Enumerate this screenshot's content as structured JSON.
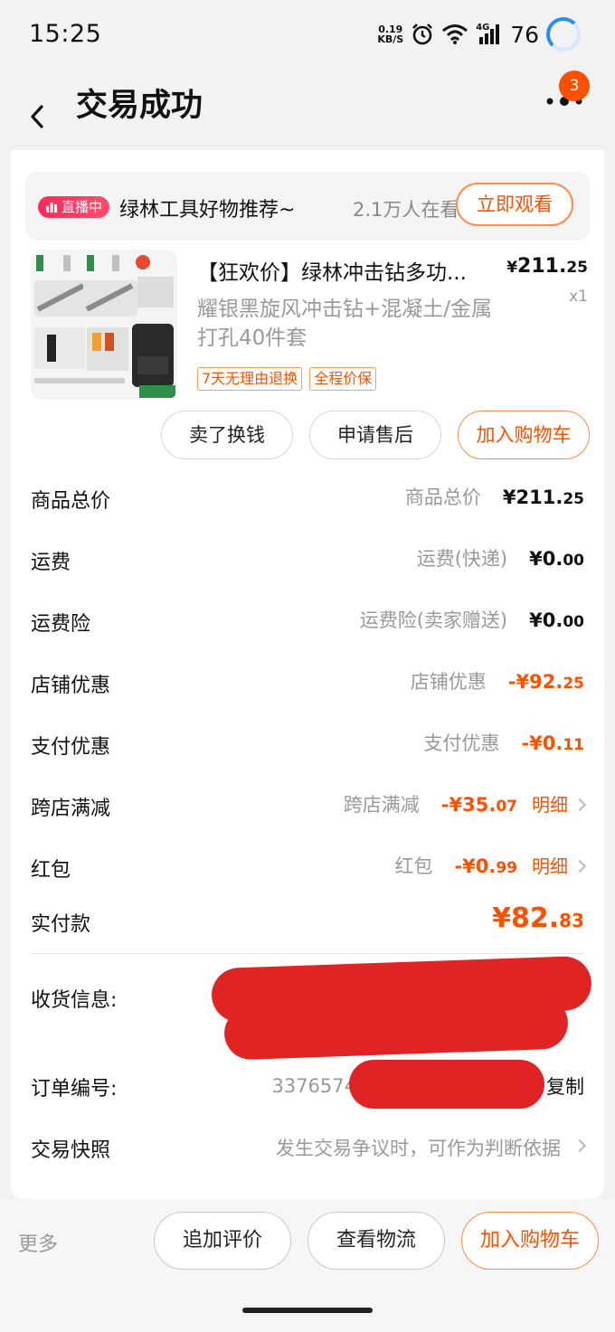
{
  "status_bar": {
    "time": "15:25",
    "net_speed_value": "0.19",
    "net_speed_unit": "KB/S",
    "network_label": "4G",
    "battery": "76"
  },
  "header": {
    "title": "交易成功",
    "badge_count": "3"
  },
  "live": {
    "badge": "直播中",
    "title": "绿林工具好物推荐~",
    "viewers": "2.1万人在看",
    "watch_button": "立即观看"
  },
  "product": {
    "title": "【狂欢价】绿林冲击钻多功...",
    "price_symbol": "¥",
    "price_int": "211.",
    "price_dec": "25",
    "quantity": "x1",
    "spec": "耀银黑旋风冲击钻+混凝土/金属打孔40件套",
    "tags": [
      "7天无理由退换",
      "全程价保"
    ],
    "actions": [
      "卖了换钱",
      "申请售后",
      "加入购物车"
    ]
  },
  "fees": [
    {
      "label": "商品总价",
      "sub": "商品总价",
      "sign": "",
      "int": "¥211.",
      "dec": "25",
      "negative": false,
      "detail": ""
    },
    {
      "label": "运费",
      "sub": "运费(快递)",
      "sign": "",
      "int": "¥0.",
      "dec": "00",
      "negative": false,
      "detail": ""
    },
    {
      "label": "运费险",
      "sub": "运费险(卖家赠送)",
      "sign": "",
      "int": "¥0.",
      "dec": "00",
      "negative": false,
      "detail": ""
    },
    {
      "label": "店铺优惠",
      "sub": "店铺优惠",
      "sign": "-",
      "int": "¥92.",
      "dec": "25",
      "negative": true,
      "detail": ""
    },
    {
      "label": "支付优惠",
      "sub": "支付优惠",
      "sign": "-",
      "int": "¥0.",
      "dec": "11",
      "negative": true,
      "detail": ""
    },
    {
      "label": "跨店满减",
      "sub": "跨店满减",
      "sign": "-",
      "int": "¥35.",
      "dec": "07",
      "negative": true,
      "detail": "明细"
    },
    {
      "label": "红包",
      "sub": "红包",
      "sign": "",
      "int": "-¥0.",
      "dec": "99",
      "negative": true,
      "detail": "明细"
    }
  ],
  "paid": {
    "label": "实付款",
    "int": "¥82.",
    "dec": "83"
  },
  "info": {
    "address_label": "收货信息:",
    "order_label": "订单编号:",
    "order_prefix": "3376574",
    "copy": "复制",
    "snapshot_label": "交易快照",
    "snapshot_value": "发生交易争议时，可作为判断依据"
  },
  "bottom_bar": {
    "more": "更多",
    "buttons": [
      "追加评价",
      "查看物流",
      "加入购物车"
    ]
  },
  "colors": {
    "accent": "#ff5000",
    "redaction": "#e02323"
  }
}
